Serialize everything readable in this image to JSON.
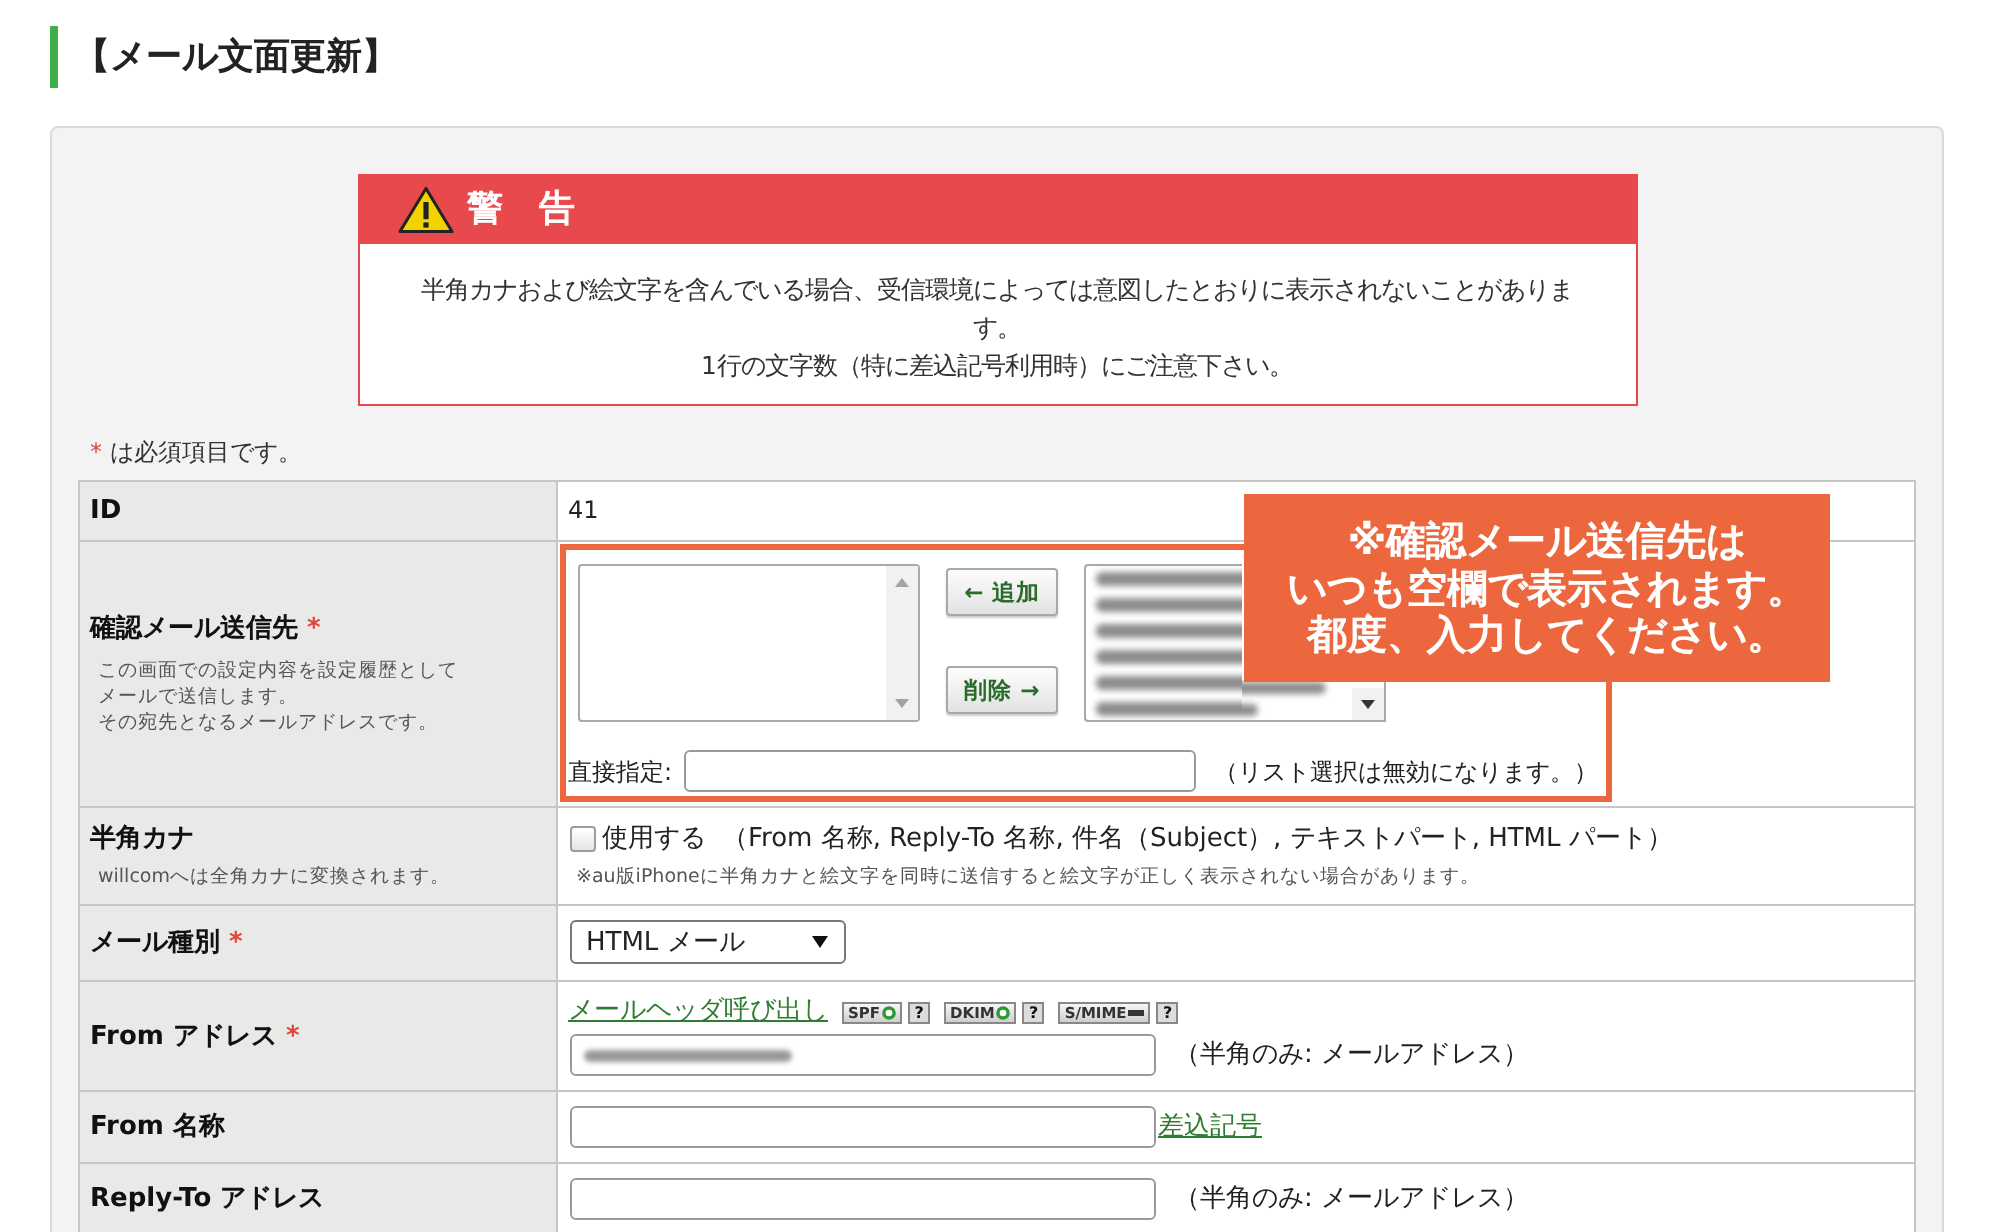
{
  "page_title": "【メール文面更新】",
  "warning": {
    "title": "警　告",
    "message": [
      "半角カナおよび絵文字を含んでいる場合、受信環境によっては意図したとおりに表示されないことがあります。",
      "1行の文字数（特に差込記号利用時）にご注意下さい。"
    ]
  },
  "required_note": {
    "mark": "*",
    "text": "は必須項目です。"
  },
  "form_rows": [
    {
      "kind": "text",
      "label": "ID",
      "value": "41"
    },
    {
      "kind": "recipients",
      "label": "確認メール送信先",
      "required_mark": "*",
      "description": [
        "この画面での設定内容を設定履歴として",
        "メールで送信します。",
        "その宛先となるメールアドレスです。"
      ],
      "add_button": "← 追加",
      "remove_button": "削除 →",
      "address_list_redacted": true,
      "direct_label": "直接指定:",
      "direct_note": "（リスト選択は無効になります。）"
    },
    {
      "kind": "checkbox",
      "label": "半角カナ",
      "description": [
        "willcomへは全角カナに変換されます。"
      ],
      "checked": false,
      "option_label": "使用する",
      "option_scope": "（From 名称, Reply-To 名称, 件名（Subject）, テキストパート, HTML パート）",
      "note": "※au版iPhoneに半角カナと絵文字を同時に送信すると絵文字が正しく表示されない場合があります。"
    },
    {
      "kind": "select",
      "label": "メール種別",
      "required_mark": "*",
      "value": "HTML メール"
    },
    {
      "kind": "input",
      "label": "From アドレス",
      "required_mark": "*",
      "header_link": "メールヘッダ呼び出し",
      "badges": [
        {
          "label": "SPF",
          "passed": true,
          "help": "?"
        },
        {
          "label": "DKIM",
          "passed": true,
          "help": "?"
        },
        {
          "label": "S/MIME",
          "passed": false,
          "help": "?"
        }
      ],
      "value_redacted": true,
      "hint": "（半角のみ: メールアドレス）"
    },
    {
      "kind": "input",
      "label": "From 名称",
      "link": "差込記号"
    },
    {
      "kind": "input",
      "label": "Reply-To アドレス",
      "hint": "（半角のみ: メールアドレス）"
    }
  ],
  "callout": {
    "lines": [
      "※確認メール送信先は",
      "いつも空欄で表示されます。",
      "都度、入力してください。"
    ]
  }
}
